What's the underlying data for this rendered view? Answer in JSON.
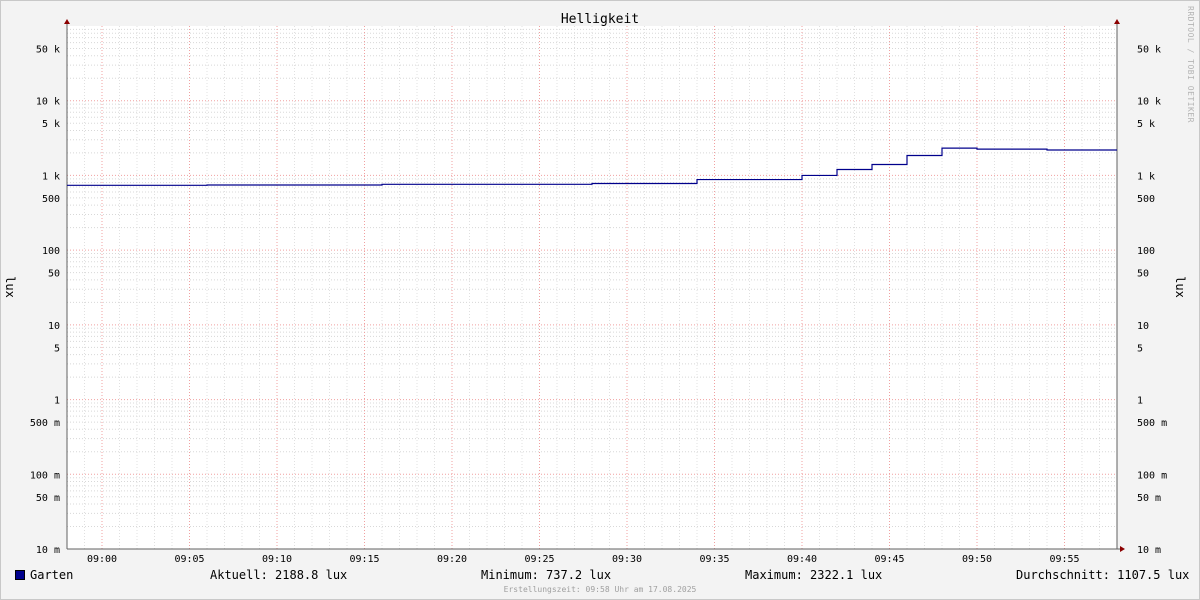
{
  "chart_data": {
    "type": "line",
    "title": "Helligkeit",
    "ylabel": "lux",
    "y_scale": "log",
    "ylim": [
      0.01,
      100000
    ],
    "y_ticks": [
      {
        "value": 50000,
        "label": "50 k"
      },
      {
        "value": 10000,
        "label": "10 k"
      },
      {
        "value": 5000,
        "label": "5 k"
      },
      {
        "value": 1000,
        "label": "1 k"
      },
      {
        "value": 500,
        "label": "500"
      },
      {
        "value": 100,
        "label": "100"
      },
      {
        "value": 50,
        "label": "50"
      },
      {
        "value": 10,
        "label": "10"
      },
      {
        "value": 5,
        "label": "5"
      },
      {
        "value": 1,
        "label": "1"
      },
      {
        "value": 0.5,
        "label": "500 m"
      },
      {
        "value": 0.1,
        "label": "100 m"
      },
      {
        "value": 0.05,
        "label": "50 m"
      },
      {
        "value": 0.01,
        "label": "10 m"
      }
    ],
    "xlim": [
      "08:58",
      "09:58"
    ],
    "x_ticks": [
      "09:00",
      "09:05",
      "09:10",
      "09:15",
      "09:20",
      "09:25",
      "09:30",
      "09:35",
      "09:40",
      "09:45",
      "09:50",
      "09:55"
    ],
    "grid": true,
    "series": [
      {
        "name": "Garten",
        "color": "#00008c",
        "step": true,
        "points": [
          {
            "x": "08:58",
            "y": 737.2
          },
          {
            "x": "09:06",
            "y": 745
          },
          {
            "x": "09:16",
            "y": 760
          },
          {
            "x": "09:28",
            "y": 780
          },
          {
            "x": "09:34",
            "y": 880
          },
          {
            "x": "09:40",
            "y": 1000
          },
          {
            "x": "09:42",
            "y": 1200
          },
          {
            "x": "09:44",
            "y": 1400
          },
          {
            "x": "09:46",
            "y": 1850
          },
          {
            "x": "09:48",
            "y": 2322.1
          },
          {
            "x": "09:50",
            "y": 2250
          },
          {
            "x": "09:54",
            "y": 2188.8
          },
          {
            "x": "09:58",
            "y": 2188.8
          }
        ]
      }
    ]
  },
  "legend": {
    "series_name": "Garten",
    "current": "Aktuell: 2188.8 lux",
    "minimum": "Minimum: 737.2 lux",
    "maximum": "Maximum: 2322.1 lux",
    "average": "Durchschnitt: 1107.5 lux"
  },
  "footer": "Erstellungszeit: 09:58 Uhr am 17.08.2025",
  "watermark": "RRDTOOL / TOBI OETIKER"
}
